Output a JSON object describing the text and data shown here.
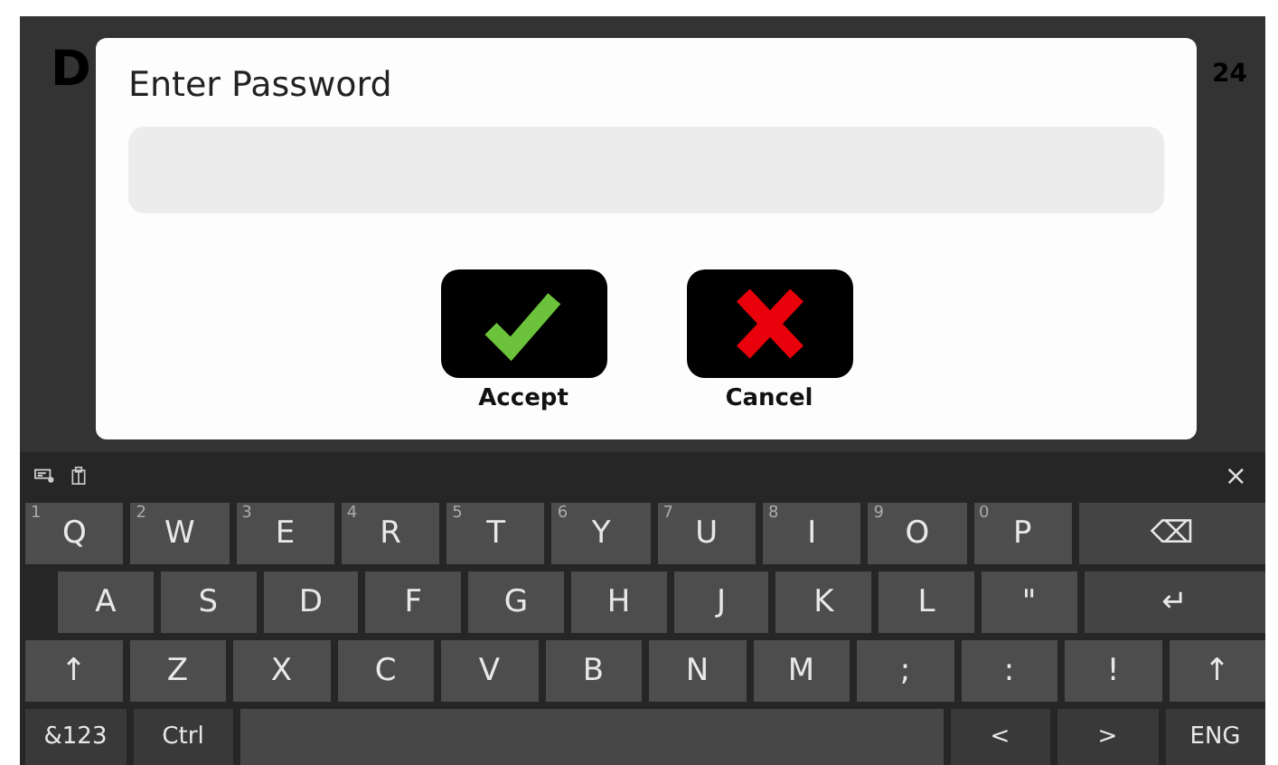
{
  "background_app": {
    "title": "D",
    "corner_text": "24"
  },
  "dialog": {
    "title": "Enter Password",
    "buttons": [
      {
        "kind": "accept",
        "label": "Accept"
      },
      {
        "kind": "cancel",
        "label": "Cancel"
      }
    ]
  },
  "keyboard": {
    "close": "×",
    "key_rows": [
      {
        "keys": [
          {
            "label": "Q",
            "hint": "1",
            "kind": "char"
          },
          {
            "label": "W",
            "hint": "2",
            "kind": "char"
          },
          {
            "label": "E",
            "hint": "3",
            "kind": "char"
          },
          {
            "label": "R",
            "hint": "4",
            "kind": "char"
          },
          {
            "label": "T",
            "hint": "5",
            "kind": "char"
          },
          {
            "label": "Y",
            "hint": "6",
            "kind": "char"
          },
          {
            "label": "U",
            "hint": "7",
            "kind": "char"
          },
          {
            "label": "I",
            "hint": "8",
            "kind": "char"
          },
          {
            "label": "O",
            "hint": "9",
            "kind": "char"
          },
          {
            "label": "P",
            "hint": "0",
            "kind": "char"
          },
          {
            "label": "⌫",
            "kind": "wide"
          }
        ]
      },
      {
        "keys": [
          {
            "label": "A",
            "kind": "char"
          },
          {
            "label": "S",
            "kind": "char"
          },
          {
            "label": "D",
            "kind": "char"
          },
          {
            "label": "F",
            "kind": "char"
          },
          {
            "label": "G",
            "kind": "char"
          },
          {
            "label": "H",
            "kind": "char"
          },
          {
            "label": "J",
            "kind": "char"
          },
          {
            "label": "K",
            "kind": "char"
          },
          {
            "label": "L",
            "kind": "char"
          },
          {
            "label": "\"",
            "kind": "char"
          },
          {
            "label": "↵",
            "kind": "wide"
          }
        ]
      },
      {
        "keys": [
          {
            "label": "↑",
            "kind": "char"
          },
          {
            "label": "Z",
            "kind": "char"
          },
          {
            "label": "X",
            "kind": "char"
          },
          {
            "label": "C",
            "kind": "char"
          },
          {
            "label": "V",
            "kind": "char"
          },
          {
            "label": "B",
            "kind": "char"
          },
          {
            "label": "N",
            "kind": "char"
          },
          {
            "label": "M",
            "kind": "char"
          },
          {
            "label": ";",
            "kind": "char"
          },
          {
            "label": ":",
            "kind": "char"
          },
          {
            "label": "!",
            "kind": "char"
          },
          {
            "label": "↑",
            "kind": "char"
          }
        ]
      },
      {
        "keys": [
          {
            "label": "&123",
            "kind": "func"
          },
          {
            "label": "Ctrl",
            "kind": "func"
          },
          {
            "kind": "space"
          },
          {
            "label": "<",
            "kind": "func"
          },
          {
            "label": ">",
            "kind": "func"
          },
          {
            "label": "ENG",
            "kind": "func"
          }
        ]
      }
    ]
  }
}
